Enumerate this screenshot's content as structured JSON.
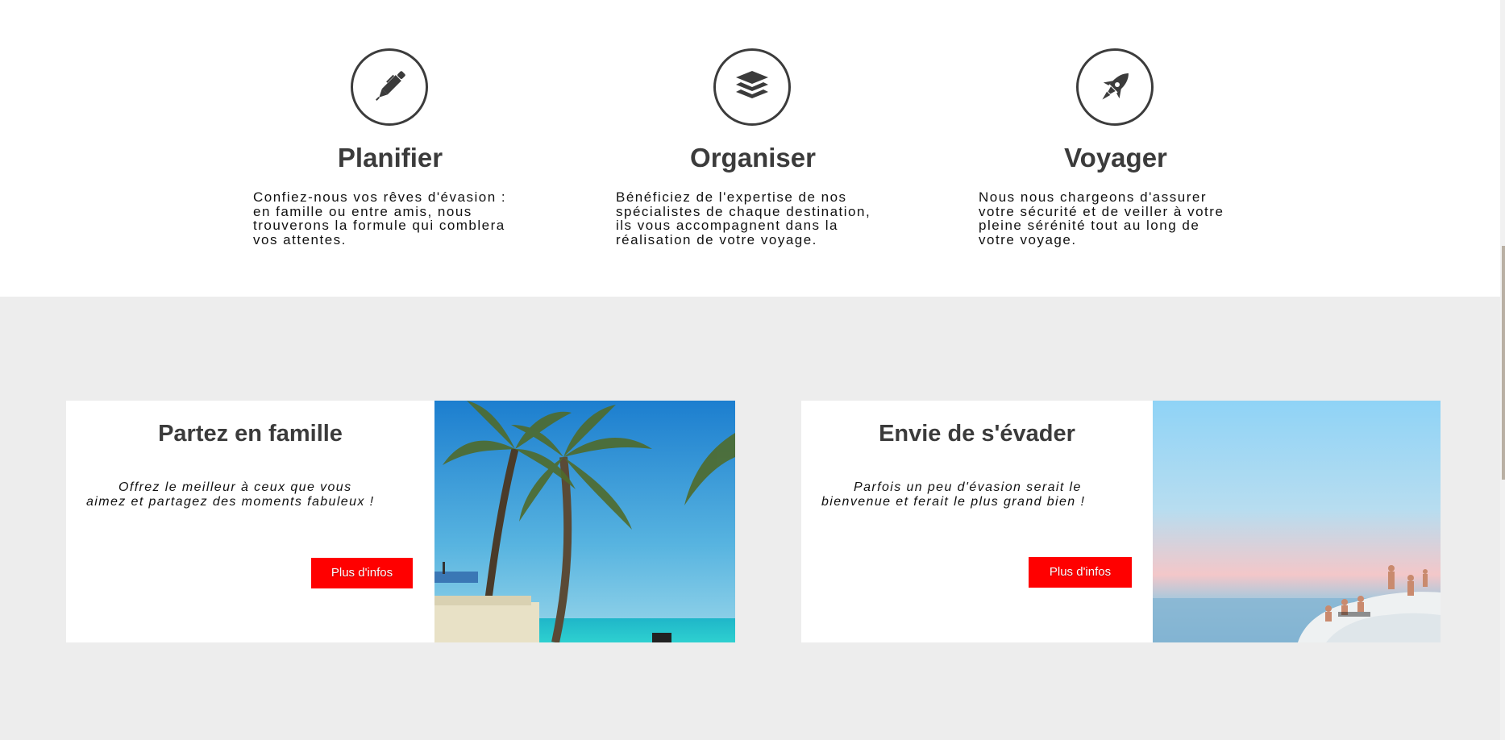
{
  "features": [
    {
      "icon": "pen-icon",
      "title": "Planifier",
      "text": "Confiez-nous vos rêves d'évasion :\nen famille ou entre amis, nous\ntrouverons la formule qui comblera\nvos attentes."
    },
    {
      "icon": "layers-icon",
      "title": "Organiser",
      "text": "Bénéficiez de l'expertise de nos\nspécialistes de chaque destination,\nils vous accompagnent dans la\nréalisation de votre voyage."
    },
    {
      "icon": "rocket-icon",
      "title": "Voyager",
      "text": "Nous nous chargeons d'assurer\nvotre sécurité et de veiller à votre\npleine sérénité tout au long de\nvotre voyage."
    }
  ],
  "promos": [
    {
      "title": "Partez en famille",
      "text": "Offrez le meilleur à ceux que vous aimez et partagez des moments fabuleux !",
      "button_label": "Plus d'infos",
      "image": "palm-beach-photo"
    },
    {
      "title": "Envie de s'évader",
      "text": "Parfois un peu d'évasion serait le bienvenue et ferait le plus grand bien !",
      "button_label": "Plus d'infos",
      "image": "beach-rocks-photo"
    }
  ],
  "colors": {
    "accent": "#ff0000",
    "heading": "#3b3b3b",
    "section_bg": "#ededed"
  }
}
